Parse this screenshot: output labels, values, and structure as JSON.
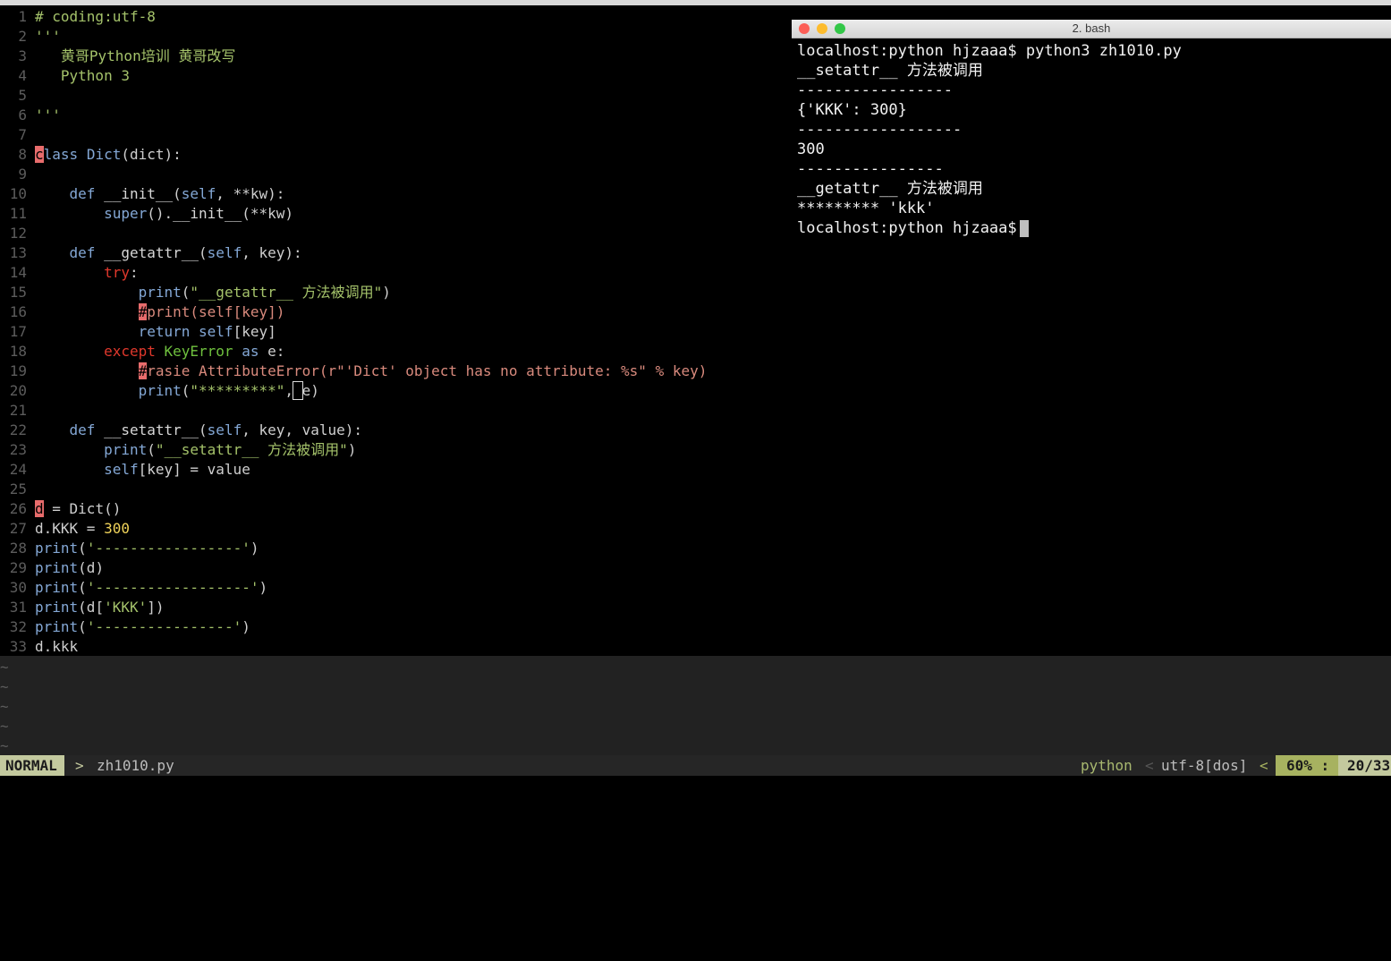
{
  "editor": {
    "lines": [
      {
        "n": "1",
        "segs": [
          {
            "t": "# coding:utf-8",
            "c": "c-comment"
          }
        ]
      },
      {
        "n": "2",
        "segs": [
          {
            "t": "'''",
            "c": "c-string"
          }
        ]
      },
      {
        "n": "3",
        "segs": [
          {
            "t": "   黄哥Python培训 黄哥改写",
            "c": "c-string"
          }
        ]
      },
      {
        "n": "4",
        "segs": [
          {
            "t": "   Python 3",
            "c": "c-string"
          }
        ]
      },
      {
        "n": "5",
        "segs": []
      },
      {
        "n": "6",
        "segs": [
          {
            "t": "'''",
            "c": "c-string"
          }
        ]
      },
      {
        "n": "7",
        "segs": []
      },
      {
        "n": "8",
        "segs": [
          {
            "t": "c",
            "c": "mark"
          },
          {
            "t": "lass ",
            "c": "c-keyword"
          },
          {
            "t": "Dict",
            "c": "c-keyword"
          },
          {
            "t": "(dict):",
            "c": "c-dim"
          }
        ]
      },
      {
        "n": "9",
        "segs": []
      },
      {
        "n": "10",
        "segs": [
          {
            "t": "    def ",
            "c": "c-keyword"
          },
          {
            "t": "__init__",
            "c": "c-func"
          },
          {
            "t": "(",
            "c": "c-dim"
          },
          {
            "t": "self",
            "c": "c-keyword"
          },
          {
            "t": ", **kw):",
            "c": "c-dim"
          }
        ]
      },
      {
        "n": "11",
        "segs": [
          {
            "t": "        super",
            "c": "c-builtin"
          },
          {
            "t": "().",
            "c": "c-dim"
          },
          {
            "t": "__init__",
            "c": "c-func"
          },
          {
            "t": "(**kw)",
            "c": "c-dim"
          }
        ]
      },
      {
        "n": "12",
        "segs": []
      },
      {
        "n": "13",
        "segs": [
          {
            "t": "    def ",
            "c": "c-keyword"
          },
          {
            "t": "__getattr__",
            "c": "c-func"
          },
          {
            "t": "(",
            "c": "c-dim"
          },
          {
            "t": "self",
            "c": "c-keyword"
          },
          {
            "t": ", key):",
            "c": "c-dim"
          }
        ]
      },
      {
        "n": "14",
        "segs": [
          {
            "t": "        try",
            "c": "c-ctrl"
          },
          {
            "t": ":",
            "c": "c-dim"
          }
        ]
      },
      {
        "n": "15",
        "segs": [
          {
            "t": "            print",
            "c": "c-builtin"
          },
          {
            "t": "(",
            "c": "c-dim"
          },
          {
            "t": "\"__getattr__ 方法被调用\"",
            "c": "c-string"
          },
          {
            "t": ")",
            "c": "c-dim"
          }
        ]
      },
      {
        "n": "16",
        "segs": [
          {
            "t": "            ",
            "c": "c-dim"
          },
          {
            "t": "#",
            "c": "mark"
          },
          {
            "t": "print(self[key])",
            "c": "c-commented"
          }
        ]
      },
      {
        "n": "17",
        "segs": [
          {
            "t": "            return ",
            "c": "c-keyword"
          },
          {
            "t": "self",
            "c": "c-keyword"
          },
          {
            "t": "[key]",
            "c": "c-dim"
          }
        ]
      },
      {
        "n": "18",
        "segs": [
          {
            "t": "        except ",
            "c": "c-ctrl"
          },
          {
            "t": "KeyError ",
            "c": "c-exc"
          },
          {
            "t": "as ",
            "c": "c-keyword"
          },
          {
            "t": "e:",
            "c": "c-dim"
          }
        ]
      },
      {
        "n": "19",
        "segs": [
          {
            "t": "            ",
            "c": "c-dim"
          },
          {
            "t": "#",
            "c": "mark"
          },
          {
            "t": "rasie AttributeError(r\"'Dict' object has no attribute: %s\" % key)",
            "c": "c-commented"
          }
        ]
      },
      {
        "n": "20",
        "segs": [
          {
            "t": "            print",
            "c": "c-builtin"
          },
          {
            "t": "(",
            "c": "c-dim"
          },
          {
            "t": "\"*********\"",
            "c": "c-string"
          },
          {
            "t": ",",
            "c": "c-dim"
          },
          {
            "t": " ",
            "c": "cursorbox"
          },
          {
            "t": "e)",
            "c": "c-dim"
          }
        ]
      },
      {
        "n": "21",
        "segs": []
      },
      {
        "n": "22",
        "segs": [
          {
            "t": "    def ",
            "c": "c-keyword"
          },
          {
            "t": "__setattr__",
            "c": "c-func"
          },
          {
            "t": "(",
            "c": "c-dim"
          },
          {
            "t": "self",
            "c": "c-keyword"
          },
          {
            "t": ", key, value):",
            "c": "c-dim"
          }
        ]
      },
      {
        "n": "23",
        "segs": [
          {
            "t": "        print",
            "c": "c-builtin"
          },
          {
            "t": "(",
            "c": "c-dim"
          },
          {
            "t": "\"__setattr__ 方法被调用\"",
            "c": "c-string"
          },
          {
            "t": ")",
            "c": "c-dim"
          }
        ]
      },
      {
        "n": "24",
        "segs": [
          {
            "t": "        self",
            "c": "c-keyword"
          },
          {
            "t": "[key] = value",
            "c": "c-dim"
          }
        ]
      },
      {
        "n": "25",
        "segs": []
      },
      {
        "n": "26",
        "segs": [
          {
            "t": "d",
            "c": "mark"
          },
          {
            "t": " = Dict()",
            "c": "c-dim"
          }
        ]
      },
      {
        "n": "27",
        "segs": [
          {
            "t": "d.KKK = ",
            "c": "c-dim"
          },
          {
            "t": "300",
            "c": "c-number"
          }
        ]
      },
      {
        "n": "28",
        "segs": [
          {
            "t": "print",
            "c": "c-builtin"
          },
          {
            "t": "(",
            "c": "c-dim"
          },
          {
            "t": "'-----------------'",
            "c": "c-string"
          },
          {
            "t": ")",
            "c": "c-dim"
          }
        ]
      },
      {
        "n": "29",
        "segs": [
          {
            "t": "print",
            "c": "c-builtin"
          },
          {
            "t": "(d)",
            "c": "c-dim"
          }
        ]
      },
      {
        "n": "30",
        "segs": [
          {
            "t": "print",
            "c": "c-builtin"
          },
          {
            "t": "(",
            "c": "c-dim"
          },
          {
            "t": "'------------------'",
            "c": "c-string"
          },
          {
            "t": ")",
            "c": "c-dim"
          }
        ]
      },
      {
        "n": "31",
        "segs": [
          {
            "t": "print",
            "c": "c-builtin"
          },
          {
            "t": "(d[",
            "c": "c-dim"
          },
          {
            "t": "'KKK'",
            "c": "c-string"
          },
          {
            "t": "])",
            "c": "c-dim"
          }
        ]
      },
      {
        "n": "32",
        "segs": [
          {
            "t": "print",
            "c": "c-builtin"
          },
          {
            "t": "(",
            "c": "c-dim"
          },
          {
            "t": "'----------------'",
            "c": "c-string"
          },
          {
            "t": ")",
            "c": "c-dim"
          }
        ]
      },
      {
        "n": "33",
        "segs": [
          {
            "t": "d.kkk",
            "c": "c-dim"
          }
        ]
      }
    ],
    "tilde": "~"
  },
  "terminal": {
    "title": "2. bash",
    "lines": [
      "localhost:python hjzaaa$ python3 zh1010.py",
      "__setattr__ 方法被调用",
      "-----------------",
      "{'KKK': 300}",
      "------------------",
      "300",
      "----------------",
      "__getattr__ 方法被调用",
      "********* 'kkk'",
      "localhost:python hjzaaa$ "
    ],
    "colors": {
      "close": "#fc5f57",
      "minimize": "#fdbc2e",
      "zoom": "#33c748"
    }
  },
  "status": {
    "mode": "NORMAL",
    "arrow": ">",
    "filename": "zh1010.py",
    "filetype": "python",
    "sep1": "<",
    "encoding": "utf-8[dos]",
    "sep2": "<",
    "percent": "60% :",
    "position": "20/33"
  }
}
